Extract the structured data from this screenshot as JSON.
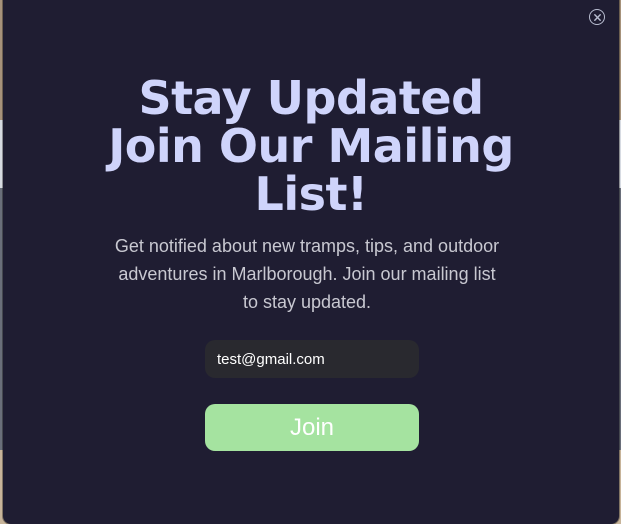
{
  "modal": {
    "close_icon": "close-icon",
    "headline": {
      "line1": "Stay Updated",
      "line2": "Join Our Mailing",
      "line3": "List!"
    },
    "subtitle": "Get notified about new tramps, tips, and outdoor adventures in Marlborough. Join our mailing list to stay updated.",
    "email_value": "test@gmail.com",
    "join_label": "Join",
    "colors": {
      "background": "#1f1d32",
      "headline": "#cfd4fb",
      "join_button": "#a5e3a0",
      "input_background": "#29292f"
    }
  }
}
